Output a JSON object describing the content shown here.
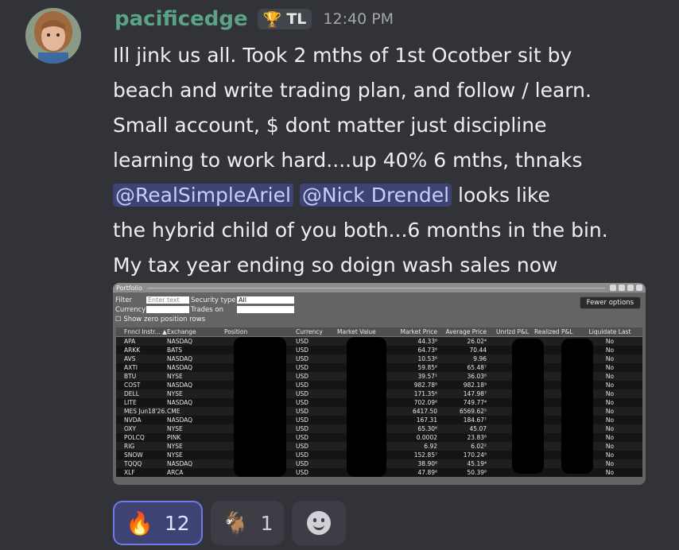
{
  "message": {
    "author": "pacificedge",
    "tag": "TL",
    "tag_icon": "trophy-icon",
    "timestamp": "12:40 PM",
    "lines": [
      "Ill jink us all. Took 2 mths of 1st Ocotber sit by",
      "beach and write trading plan, and follow / learn.",
      "Small account, $ dont matter just discipline",
      "learning to work hard....up 40% 6 mths, thnaks"
    ],
    "mention1": "@RealSimpleAriel",
    "mention2": "@Nick Drendel",
    "after_mentions": "looks like",
    "lines_after": [
      "the hybrid child of you both...6 months in the bin.",
      "My tax year ending so doign wash sales now"
    ]
  },
  "portfolio": {
    "title": "Portfolio",
    "filter_label": "Filter",
    "filter_placeholder": "Enter text",
    "security_type_label": "Security type",
    "security_type_value": "All",
    "currency_label": "Currency",
    "trades_on_label": "Trades on",
    "show_zero_label": "Show zero position rows",
    "fewer_options_label": "Fewer options",
    "columns": [
      "Fnncl Instr... ▲",
      "Exchange",
      "Position",
      "Currency",
      "Market Value",
      "Market Price",
      "Average Price",
      "Unrlzd P&L",
      "Realized P&L",
      "Liquidate Last"
    ],
    "rows": [
      {
        "sym": "APA",
        "exch": "NASDAQ",
        "cur": "USD",
        "mp": "44.33⁶",
        "ap": "26.02⁴",
        "liq": "No"
      },
      {
        "sym": "ARKK",
        "exch": "BATS",
        "cur": "USD",
        "mp": "64.73⁶",
        "ap": "70.44",
        "liq": "No"
      },
      {
        "sym": "AVS",
        "exch": "NASDAQ",
        "cur": "USD",
        "mp": "10.53⁶",
        "ap": "9.96",
        "liq": "No"
      },
      {
        "sym": "AXTI",
        "exch": "NASDAQ",
        "cur": "USD",
        "mp": "59.85⁶",
        "ap": "65.48⁷",
        "liq": "No"
      },
      {
        "sym": "BTU",
        "exch": "NYSE",
        "cur": "USD",
        "mp": "39.57¹",
        "ap": "36.03⁸",
        "liq": "No"
      },
      {
        "sym": "COST",
        "exch": "NASDAQ",
        "cur": "USD",
        "mp": "982.78⁸",
        "ap": "982.18⁹",
        "liq": "No"
      },
      {
        "sym": "DELL",
        "exch": "NYSE",
        "cur": "USD",
        "mp": "171.35⁶",
        "ap": "147.98⁷",
        "liq": "No"
      },
      {
        "sym": "LITE",
        "exch": "NASDAQ",
        "cur": "USD",
        "mp": "702.09⁶",
        "ap": "749.77⁴",
        "liq": "No"
      },
      {
        "sym": "MES Jun18'26...",
        "exch": "CME",
        "cur": "USD",
        "mp": "6417.50",
        "ap": "6569.62⁵",
        "liq": "No"
      },
      {
        "sym": "NVDA",
        "exch": "NASDAQ",
        "cur": "USD",
        "mp": "167.31",
        "ap": "184.67⁷",
        "liq": "No"
      },
      {
        "sym": "OXY",
        "exch": "NYSE",
        "cur": "USD",
        "mp": "65.30⁶",
        "ap": "45.07",
        "liq": "No"
      },
      {
        "sym": "POLCQ",
        "exch": "PINK",
        "cur": "USD",
        "mp": "0.0002",
        "ap": "23.83⁸",
        "liq": "No"
      },
      {
        "sym": "RIG",
        "exch": "NYSE",
        "cur": "USD",
        "mp": "6.92",
        "ap": "6.02²",
        "liq": "No"
      },
      {
        "sym": "SNOW",
        "exch": "NYSE",
        "cur": "USD",
        "mp": "152.85⁷",
        "ap": "170.24⁸",
        "liq": "No"
      },
      {
        "sym": "TQQQ",
        "exch": "NASDAQ",
        "cur": "USD",
        "mp": "38.90⁶",
        "ap": "45.19⁴",
        "liq": "No"
      },
      {
        "sym": "XLF",
        "exch": "ARCA",
        "cur": "USD",
        "mp": "47.89⁶",
        "ap": "50.39⁶",
        "liq": "No"
      }
    ]
  },
  "reactions": [
    {
      "emoji": "🔥",
      "icon": "fire-icon",
      "count": "12",
      "active": true
    },
    {
      "emoji": "🐐",
      "icon": "goat-icon",
      "count": "1",
      "active": false
    }
  ],
  "add_reaction_icon": "smiley-add-reaction-icon",
  "colors": {
    "username": "#5aa386",
    "mention_bg": "#3e4275",
    "active_reaction_border": "#6f79e8"
  }
}
